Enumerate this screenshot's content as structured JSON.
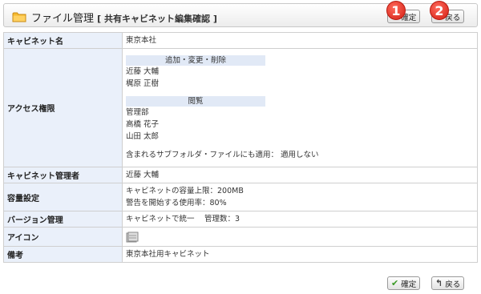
{
  "header": {
    "title": "ファイル管理",
    "subtitle": "[ 共有キャビネット編集確認 ]"
  },
  "buttons": {
    "confirm": "確定",
    "back": "戻る"
  },
  "markers": [
    "1",
    "2"
  ],
  "rows": {
    "cabinet_name": {
      "label": "キャビネット名",
      "value": "東京本社"
    },
    "access": {
      "label": "アクセス権限",
      "groups": [
        {
          "heading": "追加・変更・削除",
          "members": [
            "近藤 大輔",
            "梶原 正樹"
          ]
        },
        {
          "heading": "閲覧",
          "members": [
            "管理部",
            "高橋 花子",
            "山田 太郎"
          ]
        }
      ],
      "subfolder_note": "含まれるサブフォルダ・ファイルにも適用： 適用しない"
    },
    "admin": {
      "label": "キャビネット管理者",
      "value": "近藤 大輔"
    },
    "capacity": {
      "label": "容量設定",
      "line1": "キャビネットの容量上限：200MB",
      "line2": "警告を開始する使用率：80%"
    },
    "version": {
      "label": "バージョン管理",
      "value": "キャビネットで統一　 管理数：3"
    },
    "icon": {
      "label": "アイコン"
    },
    "note": {
      "label": "備考",
      "value": "東京本社用キャビネット"
    }
  }
}
